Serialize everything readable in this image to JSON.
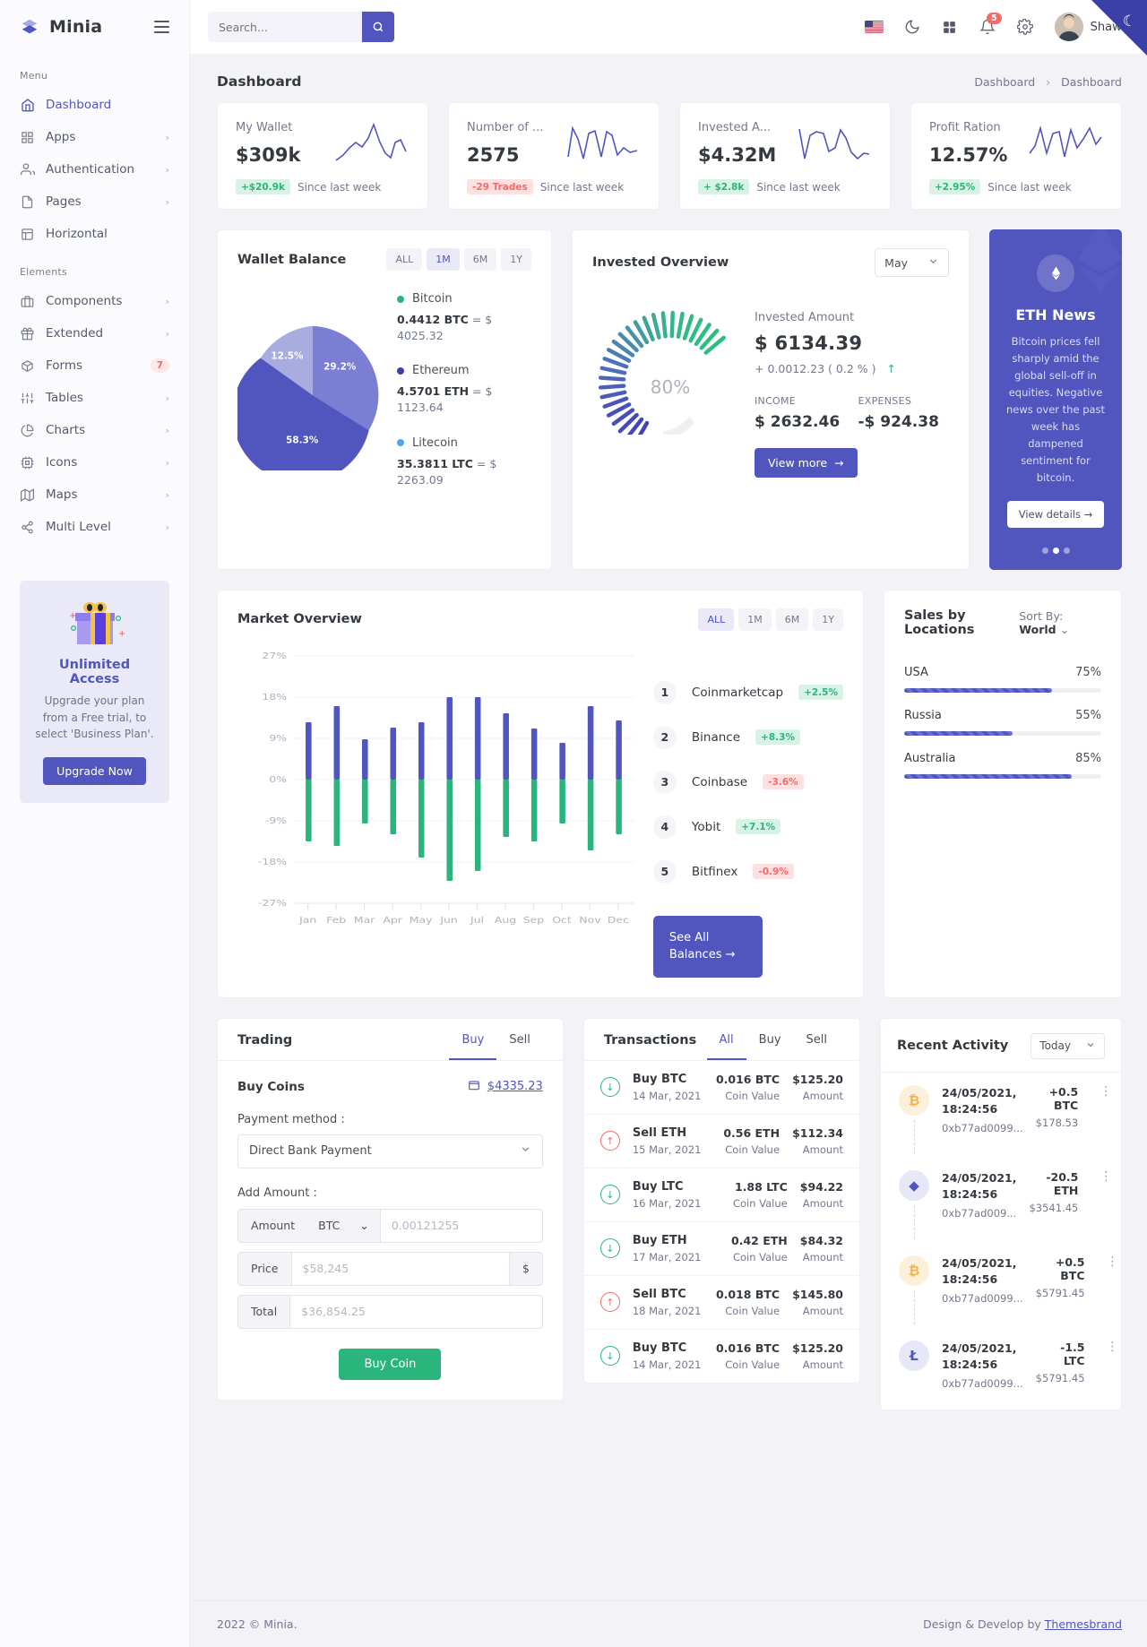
{
  "brand": {
    "name": "Minia",
    "logo_icon": "layers-icon",
    "menu_toggle_icon": "hamburger-icon"
  },
  "search": {
    "placeholder": "Search...",
    "value": "",
    "icon": "search-icon"
  },
  "topbar": {
    "flag_icon": "us-flag-icon",
    "dark_mode_icon": "moon-icon",
    "apps_icon": "grid-apps-icon",
    "bell_icon": "bell-icon",
    "notification_count": "5",
    "settings_icon": "gear-icon",
    "user_name": "Shawn",
    "avatar_icon": "user-avatar"
  },
  "sidebar": {
    "section_menu": "Menu",
    "section_elements": "Elements",
    "items": [
      {
        "label": "Dashboard",
        "icon": "home-icon",
        "active": true,
        "chevron": false
      },
      {
        "label": "Apps",
        "icon": "grid-icon",
        "chevron": true
      },
      {
        "label": "Authentication",
        "icon": "users-icon",
        "chevron": true
      },
      {
        "label": "Pages",
        "icon": "file-icon",
        "chevron": true
      },
      {
        "label": "Horizontal",
        "icon": "layout-icon",
        "chevron": false
      }
    ],
    "elements": [
      {
        "label": "Components",
        "icon": "briefcase-icon",
        "chevron": true
      },
      {
        "label": "Extended",
        "icon": "gift-icon",
        "chevron": true
      },
      {
        "label": "Forms",
        "icon": "box-icon",
        "badge": "7"
      },
      {
        "label": "Tables",
        "icon": "sliders-icon",
        "chevron": true
      },
      {
        "label": "Charts",
        "icon": "pie-chart-icon",
        "chevron": true
      },
      {
        "label": "Icons",
        "icon": "cpu-icon",
        "chevron": true
      },
      {
        "label": "Maps",
        "icon": "map-icon",
        "chevron": true
      },
      {
        "label": "Multi Level",
        "icon": "share-icon",
        "chevron": true
      }
    ],
    "promo": {
      "image_icon": "gift-box-illustration",
      "title": "Unlimited Access",
      "text": "Upgrade your plan from a Free trial, to select 'Business Plan'.",
      "button": "Upgrade Now"
    }
  },
  "page": {
    "title": "Dashboard",
    "breadcrumb_parent": "Dashboard",
    "breadcrumb_current": "Dashboard"
  },
  "stats": [
    {
      "label": "My Wallet",
      "value": "$309k",
      "chip": "+$20.9k",
      "chip_dir": "up",
      "since": "Since last week",
      "sparkline_icon": "sparkline-chart"
    },
    {
      "label": "Number of ...",
      "value": "2575",
      "chip": "-29 Trades",
      "chip_dir": "down",
      "since": "Since last week",
      "sparkline_icon": "sparkline-chart"
    },
    {
      "label": "Invested A...",
      "value": "$4.32M",
      "chip": "+ $2.8k",
      "chip_dir": "up",
      "since": "Since last week",
      "sparkline_icon": "sparkline-chart"
    },
    {
      "label": "Profit Ration",
      "value": "12.57%",
      "chip": "+2.95%",
      "chip_dir": "up",
      "since": "Since last week",
      "sparkline_icon": "sparkline-chart"
    }
  ],
  "wallet": {
    "title": "Wallet Balance",
    "ranges": [
      {
        "label": "ALL",
        "on": false
      },
      {
        "label": "1M",
        "on": true
      },
      {
        "label": "6M",
        "on": false
      },
      {
        "label": "1Y",
        "on": false
      }
    ],
    "legend": [
      {
        "name": "Bitcoin",
        "color": "#2ab57d",
        "amount": "0.4412 BTC",
        "eq": "= $ 4025.32"
      },
      {
        "name": "Ethereum",
        "color": "#3b3fa8",
        "amount": "4.5701 ETH",
        "eq": "= $ 1123.64"
      },
      {
        "name": "Litecoin",
        "color": "#4ba6ef",
        "amount": "35.3811 LTC",
        "eq": "= $ 2263.09"
      }
    ]
  },
  "invested": {
    "title": "Invested Overview",
    "month": "May",
    "gauge_value": "80%",
    "amount_label": "Invested Amount",
    "amount": "$ 6134.39",
    "delta": "+ 0.0012.23 ( 0.2 % )",
    "delta_arrow": "↑",
    "income_label": "INCOME",
    "income_value": "$ 2632.46",
    "expenses_label": "EXPENSES",
    "expenses_value": "-$ 924.38",
    "view_more": "View more"
  },
  "news": {
    "icon": "ethereum-icon",
    "title": "ETH News",
    "text": "Bitcoin prices fell sharply amid the global sell-off in equities. Negative news over the past week has dampened sentiment for bitcoin.",
    "button": "View details"
  },
  "market": {
    "title": "Market Overview",
    "ranges": [
      {
        "label": "ALL",
        "on": true
      },
      {
        "label": "1M",
        "on": false
      },
      {
        "label": "6M",
        "on": false
      },
      {
        "label": "1Y",
        "on": false
      }
    ],
    "ranking": [
      {
        "rank": "1",
        "name": "Coinmarketcap",
        "tag": "+2.5%",
        "dir": "up"
      },
      {
        "rank": "2",
        "name": "Binance",
        "tag": "+8.3%",
        "dir": "up"
      },
      {
        "rank": "3",
        "name": "Coinbase",
        "tag": "-3.6%",
        "dir": "down"
      },
      {
        "rank": "4",
        "name": "Yobit",
        "tag": "+7.1%",
        "dir": "up"
      },
      {
        "rank": "5",
        "name": "Bitfinex",
        "tag": "-0.9%",
        "dir": "down"
      }
    ],
    "see_all": "See All Balances"
  },
  "chart_data": {
    "type": "bar",
    "title": "Market Overview",
    "categories": [
      "Jan",
      "Feb",
      "Mar",
      "Apr",
      "May",
      "Jun",
      "Jul",
      "Aug",
      "Sep",
      "Oct",
      "Nov",
      "Dec"
    ],
    "series": [
      {
        "name": "Positive",
        "color": "#5156be",
        "values": [
          12.5,
          16.0,
          8.8,
          11.4,
          12.6,
          18.0,
          18.0,
          14.4,
          11.2,
          8.1,
          16.0,
          12.9
        ]
      },
      {
        "name": "Negative",
        "color": "#2ab57d",
        "values": [
          -13.5,
          -14.5,
          -9.5,
          -12.0,
          -17.0,
          -22.0,
          -20.0,
          -12.5,
          -13.5,
          -9.5,
          -15.5,
          -12.0
        ]
      }
    ],
    "ylabel": "",
    "xlabel": "",
    "ytick_labels": [
      "27%",
      "18%",
      "9%",
      "0%",
      "-9%",
      "-18%",
      "-27%"
    ],
    "ylim": [
      -27,
      27
    ],
    "grid": true,
    "legend_position": "none"
  },
  "sales": {
    "title": "Sales by Locations",
    "sort_label": "Sort By:",
    "sort_value": "World",
    "rows": [
      {
        "name": "USA",
        "pct": "75%",
        "value": 75
      },
      {
        "name": "Russia",
        "pct": "55%",
        "value": 55
      },
      {
        "name": "Australia",
        "pct": "85%",
        "value": 85
      }
    ]
  },
  "trading": {
    "title": "Trading",
    "tabs": [
      {
        "label": "Buy",
        "on": true
      },
      {
        "label": "Sell",
        "on": false
      }
    ],
    "section_title": "Buy Coins",
    "wallet_icon": "wallet-icon",
    "price_link": "$4335.23",
    "payment_label": "Payment method :",
    "payment_value": "Direct Bank Payment",
    "amount_label": "Add Amount :",
    "amount_addon": "Amount",
    "amount_currency": "BTC",
    "amount_placeholder": "0.00121255",
    "price_addon": "Price",
    "price_placeholder": "$58,245",
    "price_suffix": "$",
    "total_addon": "Total",
    "total_placeholder": "$36,854.25",
    "submit": "Buy Coin"
  },
  "transactions": {
    "title": "Transactions",
    "tabs": [
      {
        "label": "All",
        "on": true
      },
      {
        "label": "Buy",
        "on": false
      },
      {
        "label": "Sell",
        "on": false
      }
    ],
    "rows": [
      {
        "type": "buy",
        "name": "Buy BTC",
        "date": "14 Mar, 2021",
        "coin": "0.016 BTC",
        "coin_label": "Coin Value",
        "amount": "$125.20",
        "amount_label": "Amount"
      },
      {
        "type": "sell",
        "name": "Sell ETH",
        "date": "15 Mar, 2021",
        "coin": "0.56 ETH",
        "coin_label": "Coin Value",
        "amount": "$112.34",
        "amount_label": "Amount"
      },
      {
        "type": "buy",
        "name": "Buy LTC",
        "date": "16 Mar, 2021",
        "coin": "1.88 LTC",
        "coin_label": "Coin Value",
        "amount": "$94.22",
        "amount_label": "Amount"
      },
      {
        "type": "buy",
        "name": "Buy ETH",
        "date": "17 Mar, 2021",
        "coin": "0.42 ETH",
        "coin_label": "Coin Value",
        "amount": "$84.32",
        "amount_label": "Amount"
      },
      {
        "type": "sell",
        "name": "Sell BTC",
        "date": "18 Mar, 2021",
        "coin": "0.018 BTC",
        "coin_label": "Coin Value",
        "amount": "$145.80",
        "amount_label": "Amount"
      },
      {
        "type": "buy",
        "name": "Buy BTC",
        "date": "14 Mar, 2021",
        "coin": "0.016 BTC",
        "coin_label": "Coin Value",
        "amount": "$125.20",
        "amount_label": "Amount"
      }
    ]
  },
  "activity": {
    "title": "Recent Activity",
    "filter": "Today",
    "rows": [
      {
        "coin": "BTC",
        "glyph": "₿",
        "bg": "#fdf0db",
        "fg": "#f1b44c",
        "time": "24/05/2021, 18:24:56",
        "hash": "0xb77ad0099...",
        "delta": "+0.5 BTC",
        "fiat": "$178.53"
      },
      {
        "coin": "ETH",
        "glyph": "◆",
        "bg": "#e6e7f7",
        "fg": "#5156be",
        "time": "24/05/2021, 18:24:56",
        "hash": "0xb77ad009...",
        "delta": "-20.5 ETH",
        "fiat": "$3541.45"
      },
      {
        "coin": "BTC",
        "glyph": "₿",
        "bg": "#fdf0db",
        "fg": "#f1b44c",
        "time": "24/05/2021, 18:24:56",
        "hash": "0xb77ad0099...",
        "delta": "+0.5 BTC",
        "fiat": "$5791.45"
      },
      {
        "coin": "LTC",
        "glyph": "Ł",
        "bg": "#e6e7f7",
        "fg": "#5156be",
        "time": "24/05/2021, 18:24:56",
        "hash": "0xb77ad0099...",
        "delta": "-1.5 LTC",
        "fiat": "$5791.45"
      }
    ]
  },
  "footer": {
    "copyright": "2022 © Minia.",
    "credit": "Design & Develop by",
    "credit_link": "Themesbrand"
  }
}
